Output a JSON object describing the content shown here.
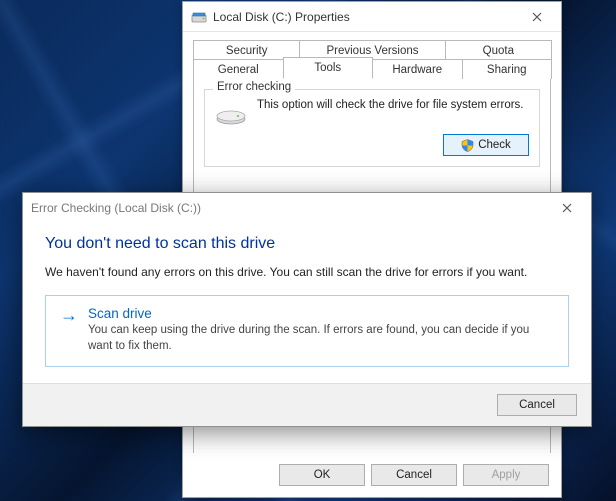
{
  "properties": {
    "title": "Local Disk (C:) Properties",
    "tabs_row1": [
      "Security",
      "Previous Versions",
      "Quota"
    ],
    "tabs_row2": [
      "General",
      "Tools",
      "Hardware",
      "Sharing"
    ],
    "active_tab": "Tools",
    "error_checking": {
      "legend": "Error checking",
      "text": "This option will check the drive for file system errors.",
      "button": "Check"
    },
    "footer": {
      "ok": "OK",
      "cancel": "Cancel",
      "apply": "Apply"
    }
  },
  "dialog": {
    "title": "Error Checking (Local Disk (C:))",
    "heading": "You don't need to scan this drive",
    "description": "We haven't found any errors on this drive. You can still scan the drive for errors if you want.",
    "option": {
      "title": "Scan drive",
      "desc": "You can keep using the drive during the scan. If errors are found, you can decide if you want to fix them."
    },
    "cancel": "Cancel"
  }
}
